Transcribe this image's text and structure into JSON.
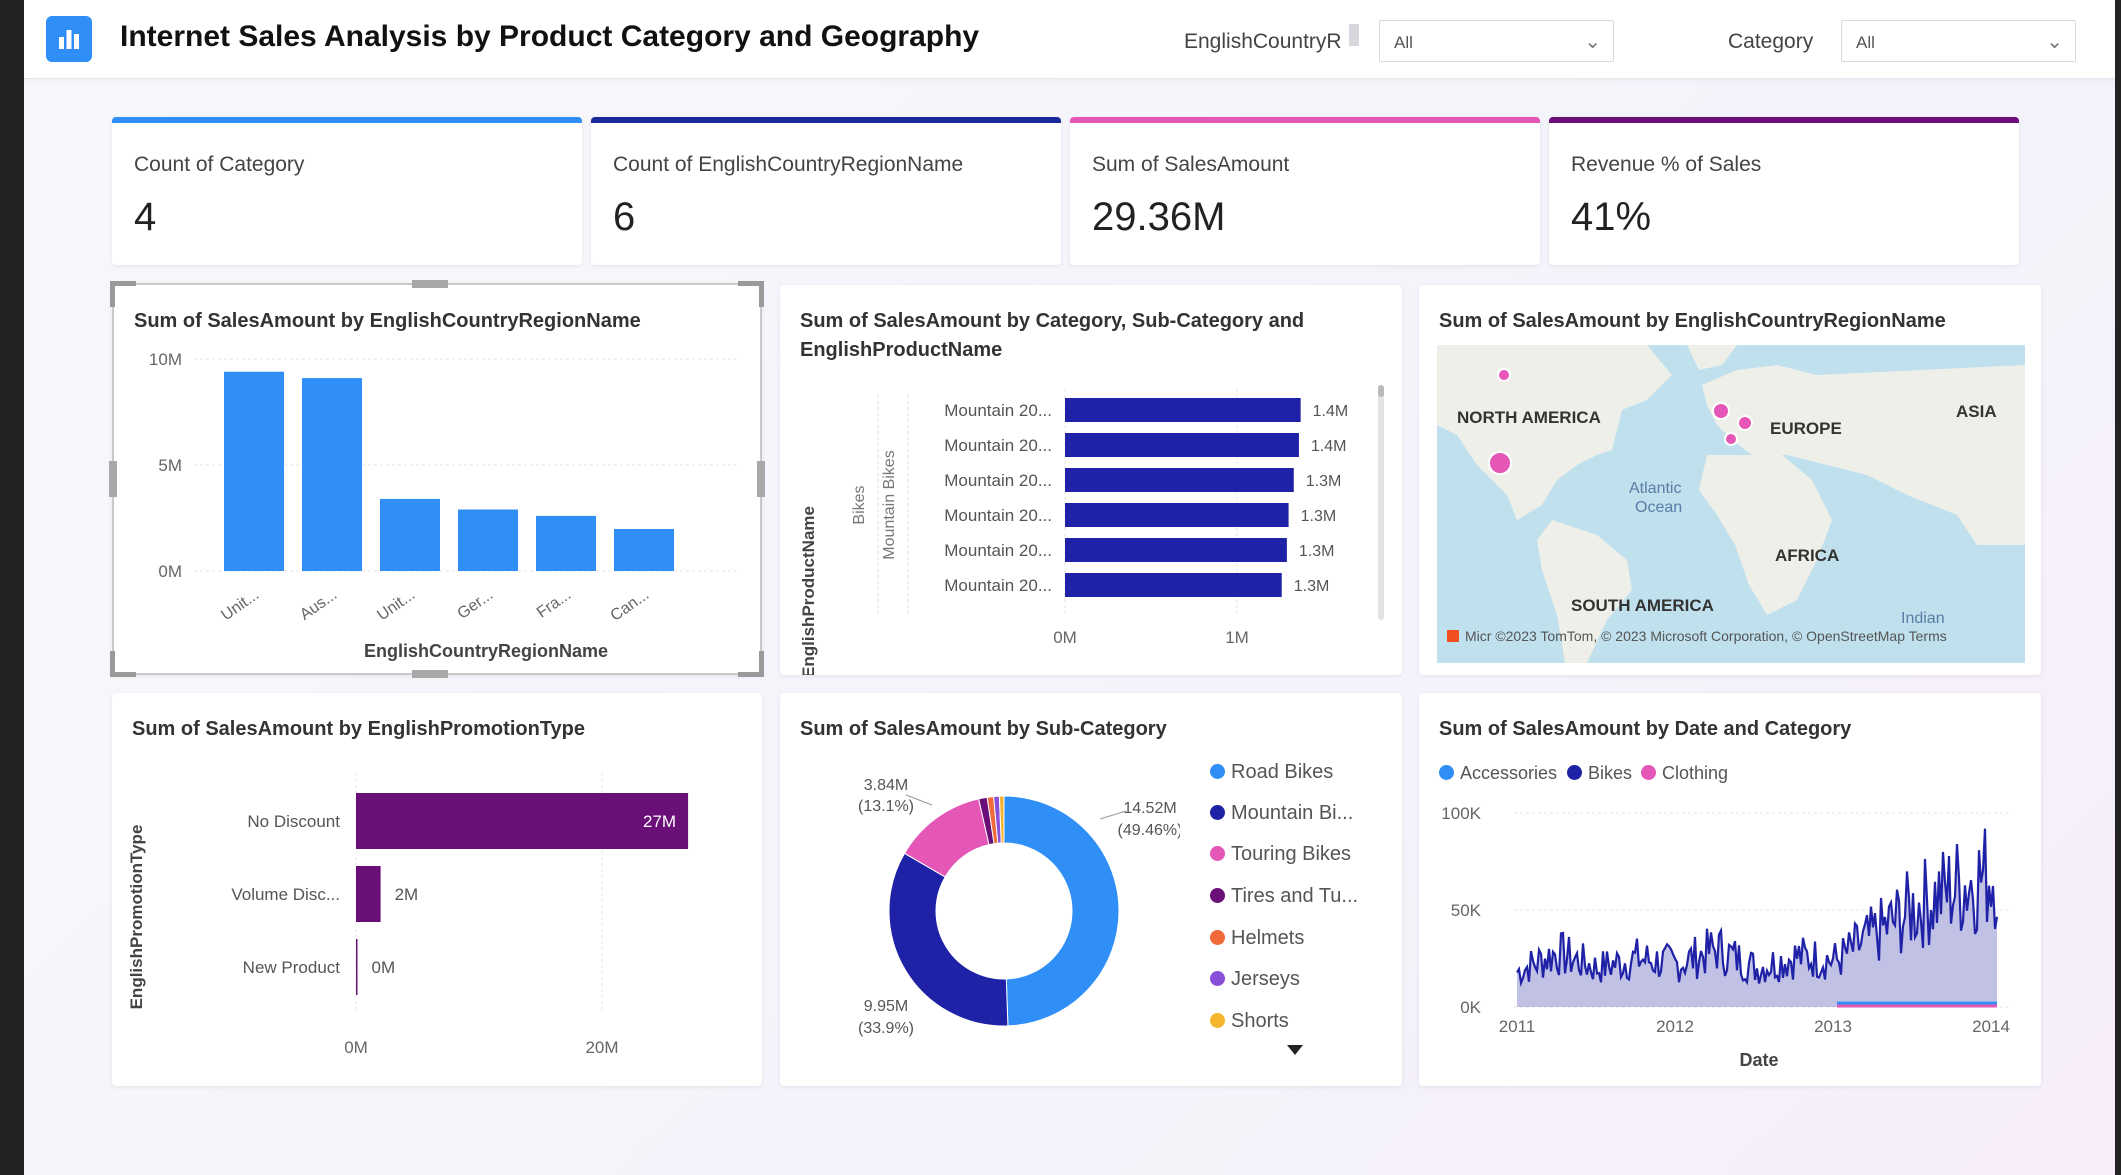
{
  "header": {
    "title": "Internet Sales Analysis by Product Category and Geography",
    "filter1_label": "EnglishCountryR",
    "filter1_value": "All",
    "filter2_label": "Category",
    "filter2_value": "All"
  },
  "kpis": [
    {
      "label": "Count of Category",
      "value": "4",
      "color": "#2f8ff7"
    },
    {
      "label": "Count of EnglishCountryRegionName",
      "value": "6",
      "color": "#1a2a9c"
    },
    {
      "label": "Sum of SalesAmount",
      "value": "29.36M",
      "color": "#e457b6"
    },
    {
      "label": "Revenue % of Sales",
      "value": "41%",
      "color": "#6a0f78"
    }
  ],
  "colors": {
    "blue": "#2f8ff7",
    "navy": "#1f22a6",
    "pink": "#e457b6",
    "purple": "#6a0f78",
    "orange": "#f06a3c",
    "violet": "#8a4fd8",
    "gold": "#f5b52e"
  },
  "country_chart": {
    "title": "Sum of SalesAmount by EnglishCountryRegionName",
    "xlabel": "EnglishCountryRegionName",
    "ticks": [
      "10M",
      "5M",
      "0M"
    ]
  },
  "product_chart": {
    "title": "Sum of SalesAmount by Category, Sub-Category and EnglishProductName",
    "ylabel": "EnglishProductName",
    "group_category": "Bikes",
    "group_subcategory": "Mountain Bikes",
    "ticks": [
      "0M",
      "1M"
    ]
  },
  "map": {
    "title": "Sum of SalesAmount by EnglishCountryRegionName",
    "labels": {
      "north_america": "NORTH AMERICA",
      "europe": "EUROPE",
      "asia": "ASIA",
      "africa": "AFRICA",
      "south_america": "SOUTH AMERICA",
      "atlantic": "Atlantic",
      "ocean": "Ocean",
      "indian": "Indian"
    },
    "attribution": "Micr ©2023 TomTom, © 2023 Microsoft Corporation, © OpenStreetMap Terms"
  },
  "promo_chart": {
    "title": "Sum of SalesAmount by EnglishPromotionType",
    "ylabel": "EnglishPromotionType",
    "ticks": [
      "0M",
      "20M"
    ]
  },
  "donut_chart": {
    "title": "Sum of SalesAmount by Sub-Category",
    "labels": {
      "pink_value": "3.84M",
      "pink_pct": "(13.1%)",
      "blue_value": "14.52M",
      "blue_pct": "(49.46%)",
      "navy_value": "9.95M",
      "navy_pct": "(33.9%)"
    },
    "legend": [
      {
        "name": "Road Bikes",
        "color": "#2f8ff7"
      },
      {
        "name": "Mountain Bi...",
        "color": "#1f22a6"
      },
      {
        "name": "Touring Bikes",
        "color": "#e457b6"
      },
      {
        "name": "Tires and Tu...",
        "color": "#6a0f78"
      },
      {
        "name": "Helmets",
        "color": "#f06a3c"
      },
      {
        "name": "Jerseys",
        "color": "#8a4fd8"
      },
      {
        "name": "Shorts",
        "color": "#f5b52e"
      }
    ]
  },
  "date_chart": {
    "title": "Sum of SalesAmount by Date and Category",
    "xlabel": "Date",
    "legend": [
      {
        "name": "Accessories",
        "color": "#2f8ff7"
      },
      {
        "name": "Bikes",
        "color": "#1f22a6"
      },
      {
        "name": "Clothing",
        "color": "#e457b6"
      }
    ],
    "yticks": [
      "100K",
      "50K",
      "0K"
    ],
    "xticks": [
      "2011",
      "2012",
      "2013",
      "2014"
    ]
  },
  "chart_data": [
    {
      "type": "bar",
      "title": "Sum of SalesAmount by EnglishCountryRegionName",
      "xlabel": "EnglishCountryRegionName",
      "ylabel": "",
      "categories": [
        "Unit...",
        "Aus...",
        "Unit...",
        "Ger...",
        "Fra...",
        "Can..."
      ],
      "values": [
        9.4,
        9.1,
        3.4,
        2.9,
        2.6,
        1.98
      ],
      "unit": "M",
      "ylim": [
        0,
        10
      ],
      "yticks": [
        "0M",
        "5M",
        "10M"
      ],
      "color": "#2f8ff7",
      "grid": true
    },
    {
      "type": "bar",
      "orientation": "horizontal",
      "title": "Sum of SalesAmount by Category, Sub-Category and EnglishProductName",
      "ylabel": "EnglishProductName",
      "categories": [
        "Mountain 20...",
        "Mountain 20...",
        "Mountain 20...",
        "Mountain 20...",
        "Mountain 20...",
        "Mountain 20..."
      ],
      "values": [
        1.37,
        1.36,
        1.33,
        1.3,
        1.29,
        1.26
      ],
      "data_labels": [
        "1.4M",
        "1.4M",
        "1.3M",
        "1.3M",
        "1.3M",
        "1.3M"
      ],
      "unit": "M",
      "xlim": [
        0,
        1.55
      ],
      "color": "#1f22a6"
    },
    {
      "type": "bar",
      "orientation": "horizontal",
      "title": "Sum of SalesAmount by EnglishPromotionType",
      "ylabel": "EnglishPromotionType",
      "categories": [
        "No Discount",
        "Volume Disc...",
        "New Product"
      ],
      "values": [
        27,
        2,
        0
      ],
      "data_labels": [
        "27M",
        "2M",
        "0M"
      ],
      "unit": "M",
      "xlim": [
        0,
        30
      ],
      "color": "#6a0f78"
    },
    {
      "type": "pie",
      "title": "Sum of SalesAmount by Sub-Category",
      "categories": [
        "Road Bikes",
        "Mountain Bi...",
        "Touring Bikes",
        "Tires and Tu...",
        "Helmets",
        "Jerseys",
        "Shorts"
      ],
      "values": [
        49.46,
        33.9,
        13.1,
        1.2,
        0.9,
        0.8,
        0.64
      ],
      "unit": "%",
      "data_labels": [
        "14.52M (49.46%)",
        "9.95M (33.9%)",
        "3.84M (13.1%)"
      ]
    },
    {
      "type": "line",
      "title": "Sum of SalesAmount by Date and Category",
      "xlabel": "Date",
      "ylim": [
        0,
        100000
      ],
      "yticks": [
        "0K",
        "50K",
        "100K"
      ],
      "x": [
        "2011-01",
        "2011-04",
        "2011-07",
        "2011-10",
        "2012-01",
        "2012-04",
        "2012-07",
        "2012-10",
        "2013-01",
        "2013-04",
        "2013-07",
        "2013-10",
        "2014-01"
      ],
      "series": [
        {
          "name": "Bikes",
          "values": [
            18000,
            28000,
            20000,
            25000,
            22000,
            30000,
            20000,
            26000,
            24000,
            38000,
            52000,
            62000,
            70000
          ]
        },
        {
          "name": "Accessories",
          "values": [
            0,
            0,
            0,
            0,
            0,
            0,
            0,
            0,
            800,
            1000,
            1200,
            1400,
            1500
          ]
        },
        {
          "name": "Clothing",
          "values": [
            0,
            0,
            0,
            0,
            0,
            0,
            0,
            0,
            500,
            700,
            800,
            900,
            1000
          ]
        }
      ]
    }
  ]
}
